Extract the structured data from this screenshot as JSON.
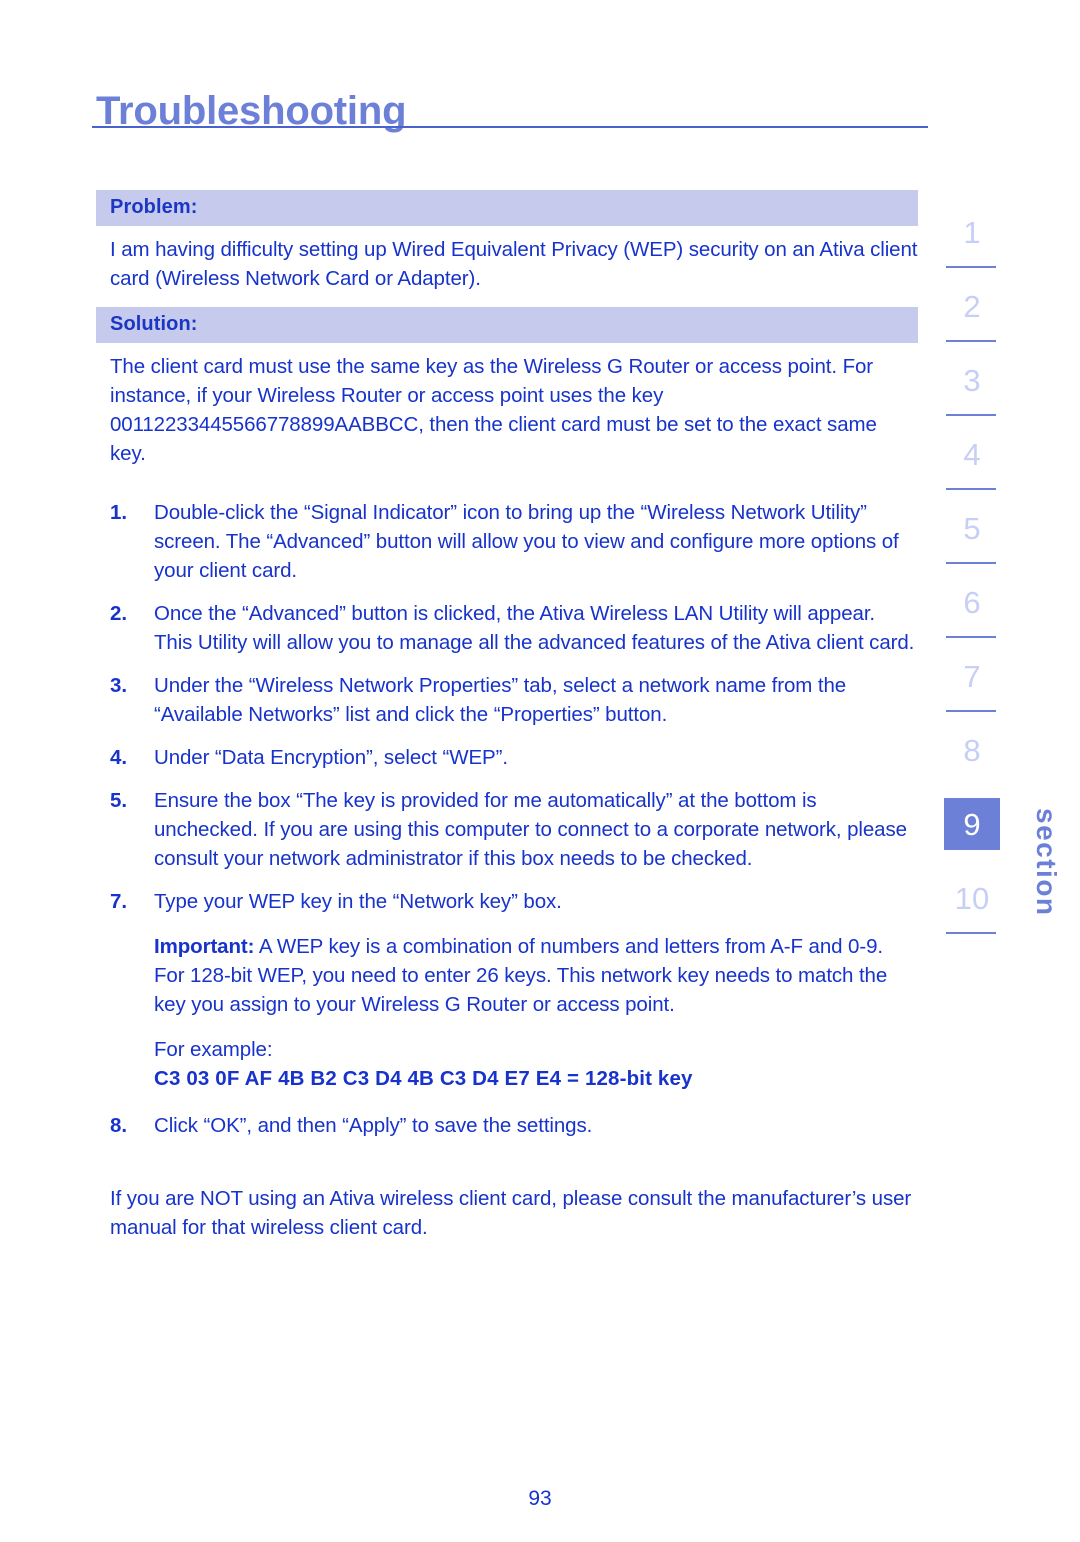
{
  "chapter": {
    "title": "Troubleshooting"
  },
  "problem": {
    "heading": "Problem:",
    "text": "I am having difficulty setting up Wired Equivalent Privacy (WEP) security on an Ativa client card (Wireless Network Card or Adapter)."
  },
  "solution": {
    "heading": "Solution:",
    "intro": "The client card must use the same key as the Wireless G Router or access point. For instance, if your Wireless Router or access point uses the key 00112233445566778899AABBCC, then the client card must be set to the exact same key.",
    "steps": [
      {
        "number": "1.",
        "text": "Double-click the “Signal Indicator” icon to bring up the “Wireless Network Utility” screen. The “Advanced” button will allow you to view and configure more options of your client card."
      },
      {
        "number": "2.",
        "text": "Once the “Advanced” button is clicked, the Ativa Wireless LAN Utility will appear. This Utility will allow you to manage all the advanced features of the Ativa client card."
      },
      {
        "number": "3.",
        "text": "Under the “Wireless Network Properties” tab, select a network name from the “Available Networks” list and click the “Properties” button."
      },
      {
        "number": "4.",
        "text": "Under “Data Encryption”, select “WEP”."
      },
      {
        "number": "5.",
        "text": "Ensure the box “The key is provided for me automatically” at the bottom is unchecked. If you are using this computer to connect to a corporate network, please consult your network administrator if this box needs to be checked."
      },
      {
        "number": "7.",
        "text": "Type your WEP key in the “Network key” box."
      }
    ],
    "important": {
      "label": "Important:",
      "text": " A WEP key is a combination of numbers and letters from A-F and 0-9. For 128-bit WEP, you need to enter 26 keys.  This network key needs to match the key you assign to your Wireless G Router or access point."
    },
    "example": {
      "label": "For example:",
      "key": "C3 03 0F AF 4B B2 C3 D4 4B C3 D4 E7 E4 = 128-bit key"
    },
    "final_step": {
      "number": "8.",
      "text": "Click “OK”, and then “Apply” to save the settings."
    },
    "closing": "If you are NOT using an Ativa wireless client card, please consult the manufacturer’s user manual for that wireless client card."
  },
  "section_rail": {
    "label": "section",
    "active": "9",
    "items": [
      {
        "number": "1",
        "active": false,
        "rule": true
      },
      {
        "number": "2",
        "active": false,
        "rule": true
      },
      {
        "number": "3",
        "active": false,
        "rule": true
      },
      {
        "number": "4",
        "active": false,
        "rule": true
      },
      {
        "number": "5",
        "active": false,
        "rule": true
      },
      {
        "number": "6",
        "active": false,
        "rule": true
      },
      {
        "number": "7",
        "active": false,
        "rule": true
      },
      {
        "number": "8",
        "active": false,
        "rule": false
      },
      {
        "number": "9",
        "active": true,
        "rule": false
      },
      {
        "number": "10",
        "active": false,
        "rule": true
      }
    ]
  },
  "footer": {
    "page_number": "93"
  },
  "colors": {
    "title_blue": "#6C80D8",
    "body_blue": "#1733CB",
    "band_background": "#C6CBEE",
    "rail_inactive": "#C7CFF4",
    "rail_active_background": "#6C80D8",
    "rule_blue": "#4A62CF"
  }
}
